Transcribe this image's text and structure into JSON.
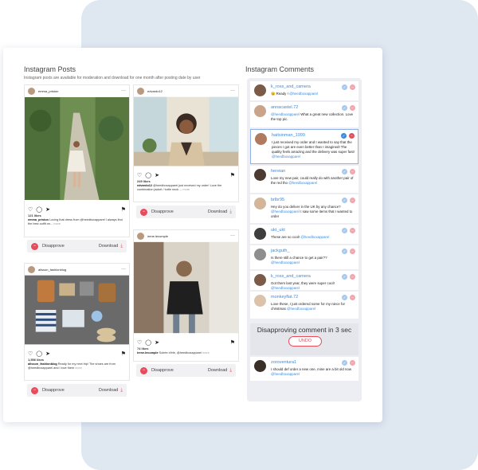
{
  "posts_panel": {
    "title": "Instagram Posts",
    "subtitle": "Instagram posts are available for moderation and download for one month after posting date by user"
  },
  "comments_panel": {
    "title": "Instagram Comments"
  },
  "posts": [
    {
      "user": "emma_priston",
      "likes": "121 likes",
      "caption_user": "emma_priston",
      "caption": "Loving that dress from @heedboxapparel",
      "caption_more": "I always find the best outfit on...",
      "more_label": "more",
      "ago": "",
      "photo": "greenery-path"
    },
    {
      "user": "edvardo12",
      "likes": "249 likes",
      "caption_user": "edvardo12",
      "caption": "@heedboxapparel just received my order!",
      "caption_more": "Love the combination jacket / turtle neck ...",
      "more_label": "more",
      "ago": "",
      "photo": "smiling-man"
    },
    {
      "user": "alisson_fashionblog",
      "likes": "1,556 likes",
      "caption_user": "alisson_fashionblog",
      "caption": "Ready for my next trip! The shoes",
      "caption_more": "are from @heedboxapparel and I love them",
      "more_label": "more",
      "ago": "",
      "photo": "flatlay"
    },
    {
      "user": "irene.lecomple",
      "likes": "74 likes",
      "caption_user": "irene.lecomple",
      "caption": "Soirée d'été, @heedboxapparel",
      "caption_more": "",
      "more_label": "more",
      "ago": "",
      "photo": "woman-street"
    }
  ],
  "actions": {
    "disapprove_label": "Disapprove",
    "download_label": "Download"
  },
  "comments": [
    {
      "user": "k_ross_and_camera",
      "text": "😉 Ready !",
      "tag": "@heedboxapparel",
      "after": ""
    },
    {
      "user": "annacastel.72",
      "text": "",
      "tag": "@heedboxapparel",
      "after": "What a great new collection. Love the top pic."
    },
    {
      "user": "haitsinman_1999",
      "text": "I just received my order and I wanted to say that the pieces I got are even better than I imagined! The quality feels amazing and the delivery was super fast!",
      "tag": "@heedboxapparel",
      "after": ""
    },
    {
      "user": "hereian",
      "text": "Love my new pair, could really do with another pair of the red tho",
      "tag": "@heedboxapparel",
      "after": ""
    },
    {
      "user": "brlbr95",
      "text": "Hey do you deliver in the UK by any chance?",
      "tag": "@heedboxapparel",
      "after": "I saw some items that I wanted to order"
    },
    {
      "user": "ukt_ukt",
      "text": "These are so cool!",
      "tag": "@heedboxapparel",
      "after": ""
    },
    {
      "user": "jackguth_",
      "text": "Is there still a chance to get a pair??",
      "tag": "@heedboxapparel",
      "after": ""
    },
    {
      "user": "k_ross_and_camera",
      "text": "Got them last year, they were super cool!",
      "tag": "@heedboxapparel",
      "after": ""
    },
    {
      "user": "monkeyflat.72",
      "text": "Love these, I just ordered some for my niece for christmas",
      "tag": "@heedboxapparel",
      "after": ""
    },
    {
      "user": "zoroventura1",
      "text": "I should def order a new one, mine are a bit old now",
      "tag": "@heedboxapparel",
      "after": ""
    }
  ],
  "toast": {
    "text": "Disapproving comment in 3 sec",
    "undo_label": "UNDO"
  },
  "colors": {
    "accent_red": "#e84b5c",
    "accent_blue": "#3a8be0",
    "bg_card": "#dfe7f1"
  }
}
